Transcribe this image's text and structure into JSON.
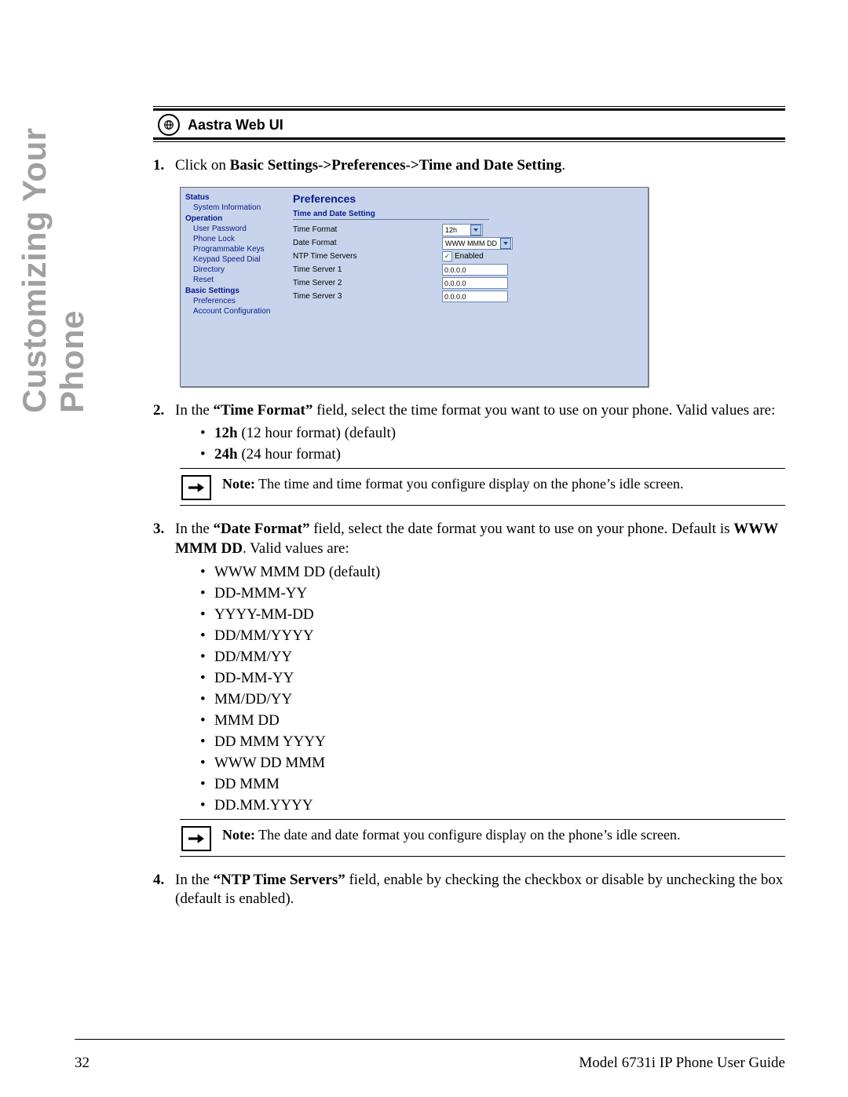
{
  "sideTitle": "Customizing Your Phone",
  "webUiLabel": "Aastra Web UI",
  "step1": {
    "num": "1.",
    "pre": "Click on ",
    "bold": "Basic Settings->Preferences->Time and Date Setting",
    "post": "."
  },
  "screenshot": {
    "nav": {
      "status": "Status",
      "sysInfo": "System Information",
      "operation": "Operation",
      "userPwd": "User Password",
      "phoneLock": "Phone Lock",
      "progKeys": "Programmable Keys",
      "speedDial": "Keypad Speed Dial",
      "directory": "Directory",
      "reset": "Reset",
      "basic": "Basic Settings",
      "prefs": "Preferences",
      "acctCfg": "Account Configuration"
    },
    "title": "Preferences",
    "section": "Time and Date Setting",
    "rows": {
      "timeFormat": {
        "label": "Time Format",
        "value": "12h"
      },
      "dateFormat": {
        "label": "Date Format",
        "value": "WWW MMM DD"
      },
      "ntp": {
        "label": "NTP Time Servers",
        "value": "Enabled"
      },
      "ts1": {
        "label": "Time Server 1",
        "value": "0.0.0.0"
      },
      "ts2": {
        "label": "Time Server 2",
        "value": "0.0.0.0"
      },
      "ts3": {
        "label": "Time Server 3",
        "value": "0.0.0.0"
      }
    }
  },
  "step2": {
    "num": "2.",
    "p1a": "In the ",
    "p1b": "“Time Format”",
    "p1c": " field, select the time format you want to use on your phone. Valid values are:",
    "b1a": "12h",
    "b1b": " (12 hour format) (default)",
    "b2a": "24h",
    "b2b": " (24 hour format)"
  },
  "note1": {
    "label": "Note:",
    "text": " The time and time format you configure display on the phone’s idle screen."
  },
  "step3": {
    "num": "3.",
    "p1a": "In the ",
    "p1b": "“Date Format”",
    "p1c": " field, select the date format you want to use on your phone. Default is ",
    "p1d": "WWW MMM DD",
    "p1e": ". Valid values are:",
    "bullets": [
      "WWW MMM DD (default)",
      "DD-MMM-YY",
      "YYYY-MM-DD",
      "DD/MM/YYYY",
      "DD/MM/YY",
      "DD-MM-YY",
      "MM/DD/YY",
      "MMM DD",
      "DD MMM YYYY",
      "WWW DD MMM",
      "DD MMM",
      "DD.MM.YYYY"
    ]
  },
  "note2": {
    "label": "Note:",
    "text": " The date and date format you configure display on the phone’s idle screen."
  },
  "step4": {
    "num": "4.",
    "p1a": "In the ",
    "p1b": "“NTP Time Servers”",
    "p1c": " field, enable by checking the checkbox or disable by unchecking the box (default is enabled)."
  },
  "footer": {
    "page": "32",
    "guide": "Model 6731i IP Phone User Guide"
  }
}
